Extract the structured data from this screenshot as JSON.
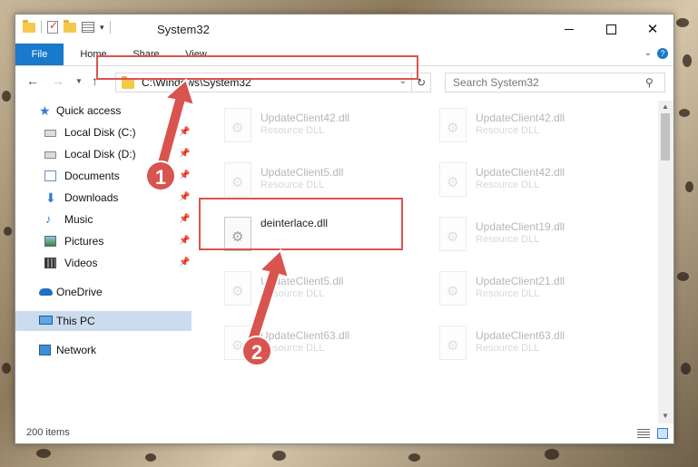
{
  "window": {
    "title": "System32",
    "item_count": "200 items"
  },
  "ribbon": {
    "tabs": [
      "File",
      "Home",
      "Share",
      "View"
    ]
  },
  "navigation": {
    "address": "C:\\Windows\\System32",
    "search_placeholder": "Search System32"
  },
  "sidebar": {
    "items": [
      {
        "label": "Quick access",
        "icon": "star-icon",
        "pinned": false
      },
      {
        "label": "Local Disk (C:)",
        "icon": "drive-icon",
        "pinned": true
      },
      {
        "label": "Local Disk (D:)",
        "icon": "drive-icon",
        "pinned": true
      },
      {
        "label": "Documents",
        "icon": "documents-icon",
        "pinned": true
      },
      {
        "label": "Downloads",
        "icon": "download-icon",
        "pinned": true
      },
      {
        "label": "Music",
        "icon": "music-icon",
        "pinned": true
      },
      {
        "label": "Pictures",
        "icon": "pictures-icon",
        "pinned": true
      },
      {
        "label": "Videos",
        "icon": "videos-icon",
        "pinned": true
      },
      {
        "label": "OneDrive",
        "icon": "cloud-icon",
        "pinned": false
      },
      {
        "label": "This PC",
        "icon": "computer-icon",
        "pinned": false,
        "selected": true
      },
      {
        "label": "Network",
        "icon": "network-icon",
        "pinned": false
      }
    ]
  },
  "files": [
    {
      "name": "UpdateClient42.dll",
      "type": "Resource DLL",
      "faded": true
    },
    {
      "name": "UpdateClient42.dll",
      "type": "Resource DLL",
      "faded": true
    },
    {
      "name": "UpdateClient5.dll",
      "type": "Resource DLL",
      "faded": true
    },
    {
      "name": "UpdateClient42.dll",
      "type": "Resource DLL",
      "faded": true
    },
    {
      "name": "deinterlace.dll",
      "type": "",
      "faded": false
    },
    {
      "name": "UpdateClient19.dll",
      "type": "Resource DLL",
      "faded": true
    },
    {
      "name": "UpdateClient5.dll",
      "type": "Resource DLL",
      "faded": true
    },
    {
      "name": "UpdateClient21.dll",
      "type": "Resource DLL",
      "faded": true
    },
    {
      "name": "UpdateClient63.dll",
      "type": "Resource DLL",
      "faded": true
    },
    {
      "name": "UpdateClient63.dll",
      "type": "Resource DLL",
      "faded": true
    }
  ],
  "annotations": {
    "step1": "1",
    "step2": "2",
    "color": "#d9534f"
  }
}
